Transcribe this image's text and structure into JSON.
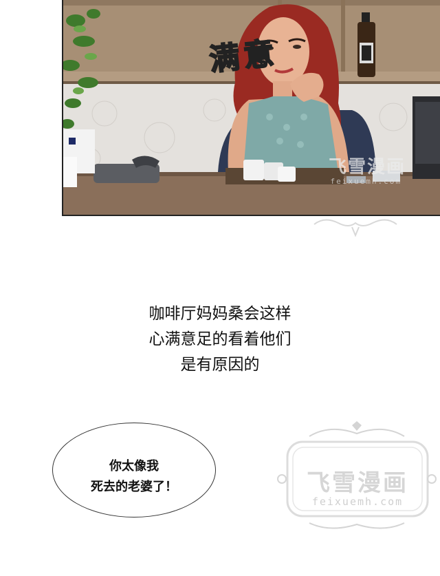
{
  "panel": {
    "sfx": "满意",
    "watermark_title": "飞雪漫画",
    "watermark_url": "feixuemh.com"
  },
  "narration": {
    "lines": [
      "咖啡厅妈妈桑会这样",
      "心满意足的看着他们",
      "是有原因的"
    ]
  },
  "bubble": {
    "lines": [
      "你太像我",
      "死去的老婆了！"
    ]
  },
  "watermark": {
    "title": "飞雪漫画",
    "url": "feixuemh.com"
  }
}
